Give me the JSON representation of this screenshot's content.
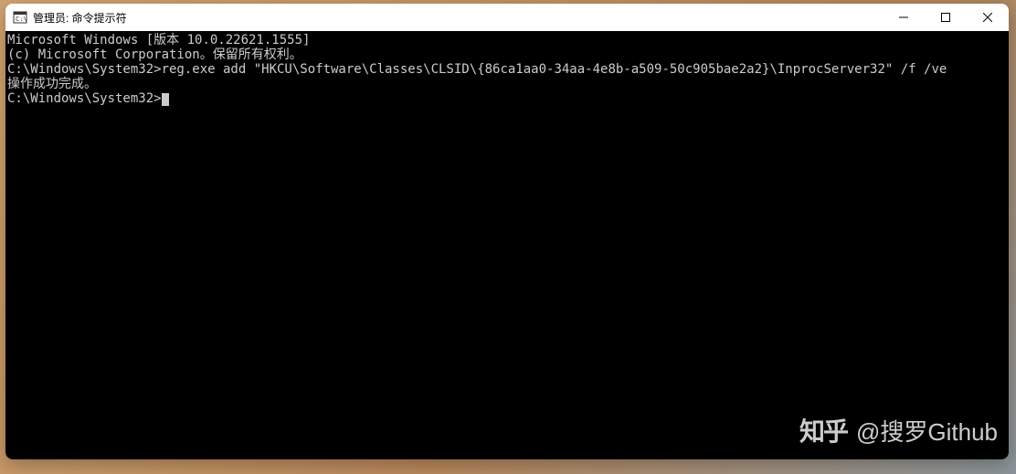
{
  "window": {
    "title": "管理员: 命令提示符"
  },
  "terminal": {
    "line1": "Microsoft Windows [版本 10.0.22621.1555]",
    "line2": "(c) Microsoft Corporation。保留所有权利。",
    "blank1": "",
    "line3": "C:\\Windows\\System32>reg.exe add \"HKCU\\Software\\Classes\\CLSID\\{86ca1aa0-34aa-4e8b-a509-50c905bae2a2}\\InprocServer32\" /f /ve",
    "line4": "操作成功完成。",
    "blank2": "",
    "prompt": "C:\\Windows\\System32>"
  },
  "watermark": {
    "logo": "知乎",
    "text": "@搜罗Github"
  }
}
